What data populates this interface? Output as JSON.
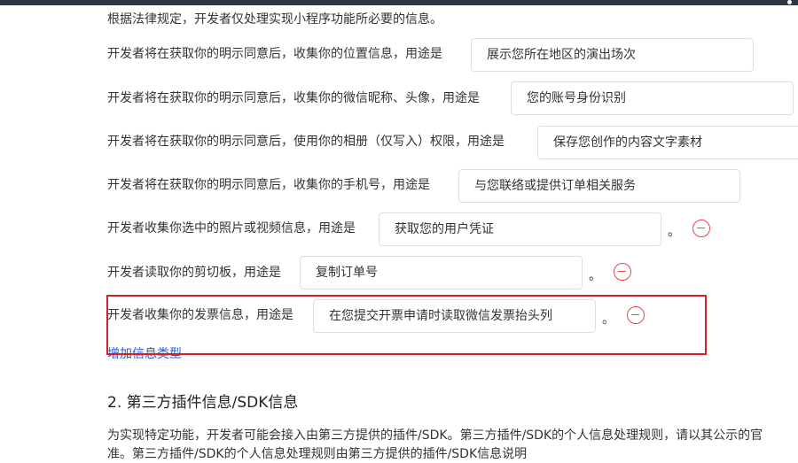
{
  "intro": "根据法律规定，开发者仅处理实现小程序功能所必要的信息。",
  "rows": [
    {
      "label": "开发者将在获取你的明示同意后，收集你的位置信息，用途是",
      "value": "展示您所在地区的演出场次"
    },
    {
      "label": "开发者将在获取你的明示同意后，收集你的微信昵称、头像，用途是",
      "value": "您的账号身份识别"
    },
    {
      "label": "开发者将在获取你的明示同意后，使用你的相册（仅写入）权限，用途是",
      "value": "保存您创作的内容文字素材"
    },
    {
      "label": "开发者将在获取你的明示同意后，收集你的手机号，用途是",
      "value": "与您联络或提供订单相关服务"
    },
    {
      "label": "开发者收集你选中的照片或视频信息，用途是",
      "value": "获取您的用户凭证",
      "suffix": "。"
    },
    {
      "label": "开发者读取你的剪切板，用途是",
      "value": "复制订单号",
      "suffix": "。"
    },
    {
      "label": "开发者收集你的发票信息，用途是",
      "value": "在您提交开票申请时读取微信发票抬头列",
      "suffix": "。"
    }
  ],
  "add_link": "增加信息类型",
  "section": {
    "title": "2.  第三方插件信息/SDK信息",
    "line1": "为实现特定功能，开发者可能会接入由第三方提供的插件/SDK。第三方插件/SDK的个人信息处理规则，请以其公示的官",
    "line2": "准。第三方插件/SDK的个人信息处理规则由第三方提供的插件/SDK信息说明"
  },
  "colors": {
    "accent_link": "#2b5dd9",
    "remove": "#e5484d",
    "highlight": "#d61f26",
    "topbar": "#2f3445"
  }
}
